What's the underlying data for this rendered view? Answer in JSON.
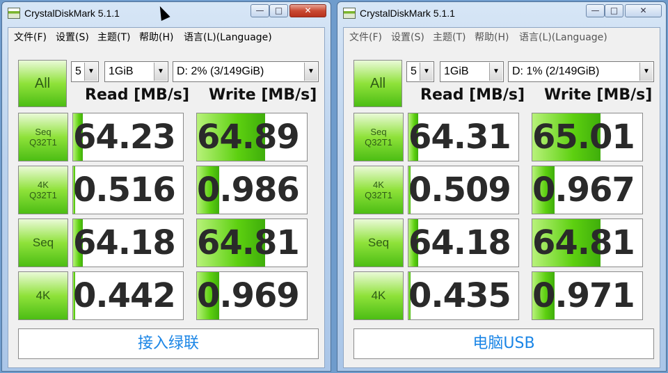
{
  "windows": [
    {
      "title": "CrystalDiskMark 5.1.1",
      "controls": {
        "minimize": "—",
        "maximize": "□",
        "close": "✕"
      },
      "menu": [
        "文件(F)",
        "设置(S)",
        "主题(T)",
        "帮助(H)",
        "语言(L)(Language)"
      ],
      "all_label": "All",
      "count": "5",
      "size": "1GiB",
      "drive": "D: 2% (3/149GiB)",
      "read_header": "Read [MB/s]",
      "write_header": "Write [MB/s]",
      "rows": [
        {
          "label1": "Seq",
          "label2": "Q32T1",
          "read": "64.23",
          "write": "64.89",
          "read_fill": 0.09,
          "write_fill": 0.62
        },
        {
          "label1": "4K",
          "label2": "Q32T1",
          "read": "0.516",
          "write": "0.986",
          "read_fill": 0.02,
          "write_fill": 0.2
        },
        {
          "label1": "Seq",
          "label2": "",
          "read": "64.18",
          "write": "64.81",
          "read_fill": 0.09,
          "write_fill": 0.62
        },
        {
          "label1": "4K",
          "label2": "",
          "read": "0.442",
          "write": "0.969",
          "read_fill": 0.02,
          "write_fill": 0.2
        }
      ],
      "comment": "接入绿联"
    },
    {
      "title": "CrystalDiskMark 5.1.1",
      "controls": {
        "minimize": "—",
        "maximize": "□",
        "close": "✕"
      },
      "menu": [
        "文件(F)",
        "设置(S)",
        "主题(T)",
        "帮助(H)",
        "语言(L)(Language)"
      ],
      "all_label": "All",
      "count": "5",
      "size": "1GiB",
      "drive": "D: 1% (2/149GiB)",
      "read_header": "Read [MB/s]",
      "write_header": "Write [MB/s]",
      "rows": [
        {
          "label1": "Seq",
          "label2": "Q32T1",
          "read": "64.31",
          "write": "65.01",
          "read_fill": 0.09,
          "write_fill": 0.62
        },
        {
          "label1": "4K",
          "label2": "Q32T1",
          "read": "0.509",
          "write": "0.967",
          "read_fill": 0.02,
          "write_fill": 0.2
        },
        {
          "label1": "Seq",
          "label2": "",
          "read": "64.18",
          "write": "64.81",
          "read_fill": 0.09,
          "write_fill": 0.62
        },
        {
          "label1": "4K",
          "label2": "",
          "read": "0.435",
          "write": "0.971",
          "read_fill": 0.02,
          "write_fill": 0.2
        }
      ],
      "comment": "电脑USB"
    }
  ]
}
